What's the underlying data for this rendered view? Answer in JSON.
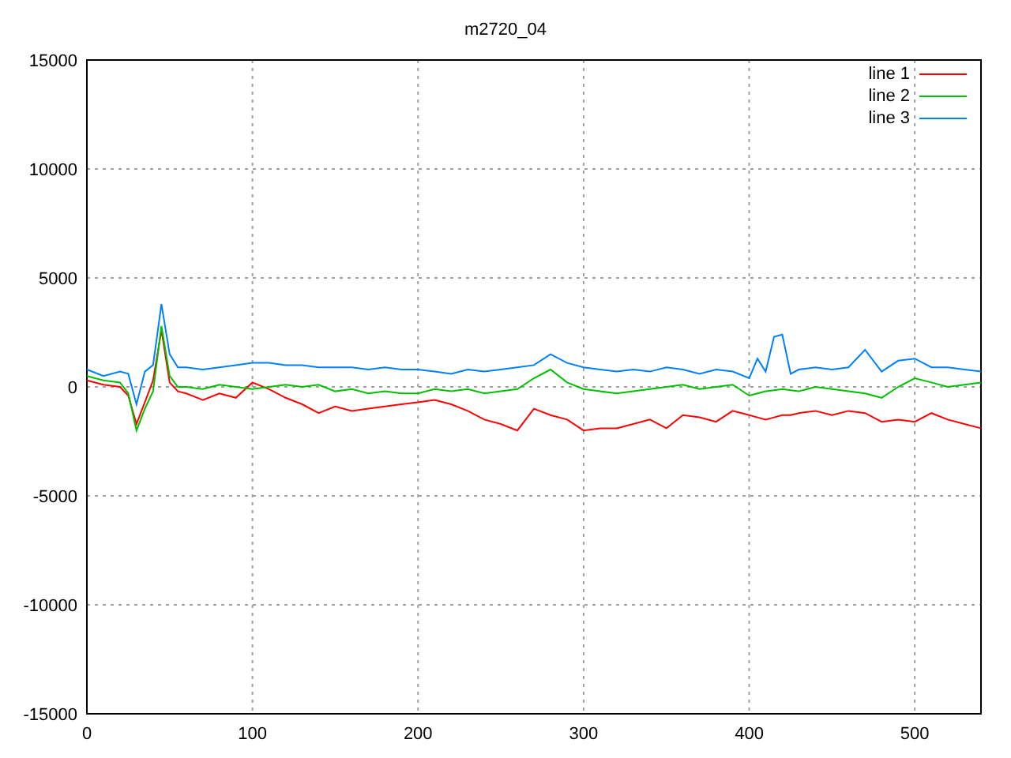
{
  "chart": {
    "chart_data": {
      "type": "line",
      "title": "m2720_04",
      "x": [
        0,
        10,
        20,
        25,
        30,
        35,
        40,
        45,
        50,
        55,
        60,
        70,
        80,
        90,
        100,
        110,
        120,
        130,
        140,
        150,
        160,
        170,
        180,
        190,
        200,
        210,
        220,
        230,
        240,
        250,
        260,
        270,
        280,
        290,
        300,
        310,
        320,
        330,
        340,
        350,
        360,
        370,
        380,
        390,
        400,
        405,
        410,
        415,
        420,
        425,
        430,
        440,
        450,
        460,
        470,
        480,
        490,
        500,
        510,
        520,
        530,
        540
      ],
      "series": [
        {
          "name": "line 1",
          "color": "#ff0000",
          "values": [
            300,
            100,
            0,
            -400,
            -1700,
            -700,
            300,
            2600,
            200,
            -200,
            -300,
            -600,
            -300,
            -500,
            200,
            -100,
            -500,
            -800,
            -1200,
            -900,
            -1100,
            -1000,
            -900,
            -800,
            -700,
            -600,
            -800,
            -1100,
            -1500,
            -1700,
            -2000,
            -1000,
            -1300,
            -1500,
            -2000,
            -1900,
            -1900,
            -1700,
            -1500,
            -1900,
            -1300,
            -1400,
            -1600,
            -1100,
            -1300,
            -1400,
            -1500,
            -1400,
            -1300,
            -1300,
            -1200,
            -1100,
            -1300,
            -1100,
            -1200,
            -1600,
            -1500,
            -1600,
            -1200,
            -1500,
            -1700,
            -1900
          ]
        },
        {
          "name": "line 2",
          "color": "#00c000",
          "values": [
            500,
            300,
            200,
            -300,
            -2000,
            -1000,
            -200,
            2800,
            500,
            0,
            0,
            -100,
            100,
            0,
            -100,
            0,
            100,
            0,
            100,
            -200,
            -100,
            -300,
            -200,
            -300,
            -300,
            -100,
            -200,
            -100,
            -300,
            -200,
            -100,
            400,
            800,
            200,
            -100,
            -200,
            -300,
            -200,
            -100,
            0,
            100,
            -100,
            0,
            100,
            -400,
            -300,
            -200,
            -150,
            -100,
            -150,
            -200,
            0,
            -100,
            -200,
            -300,
            -500,
            0,
            400,
            200,
            0,
            100,
            200
          ]
        },
        {
          "name": "line 3",
          "color": "#0080ff",
          "values": [
            800,
            500,
            700,
            600,
            -800,
            700,
            1000,
            3800,
            1500,
            900,
            900,
            800,
            900,
            1000,
            1100,
            1100,
            1000,
            1000,
            900,
            900,
            900,
            800,
            900,
            800,
            800,
            700,
            600,
            800,
            700,
            800,
            900,
            1000,
            1500,
            1100,
            900,
            800,
            700,
            800,
            700,
            900,
            800,
            600,
            800,
            700,
            400,
            1300,
            700,
            2300,
            2400,
            600,
            800,
            900,
            800,
            900,
            1700,
            700,
            1200,
            1300,
            900,
            900,
            800,
            700
          ]
        }
      ],
      "grid": true,
      "legend": true,
      "xlim": [
        0,
        540
      ],
      "ylim": [
        -15000,
        15000
      ],
      "xticks": [
        0,
        100,
        200,
        300,
        400,
        500
      ],
      "yticks": [
        -15000,
        -10000,
        -5000,
        0,
        5000,
        10000,
        15000
      ]
    }
  }
}
